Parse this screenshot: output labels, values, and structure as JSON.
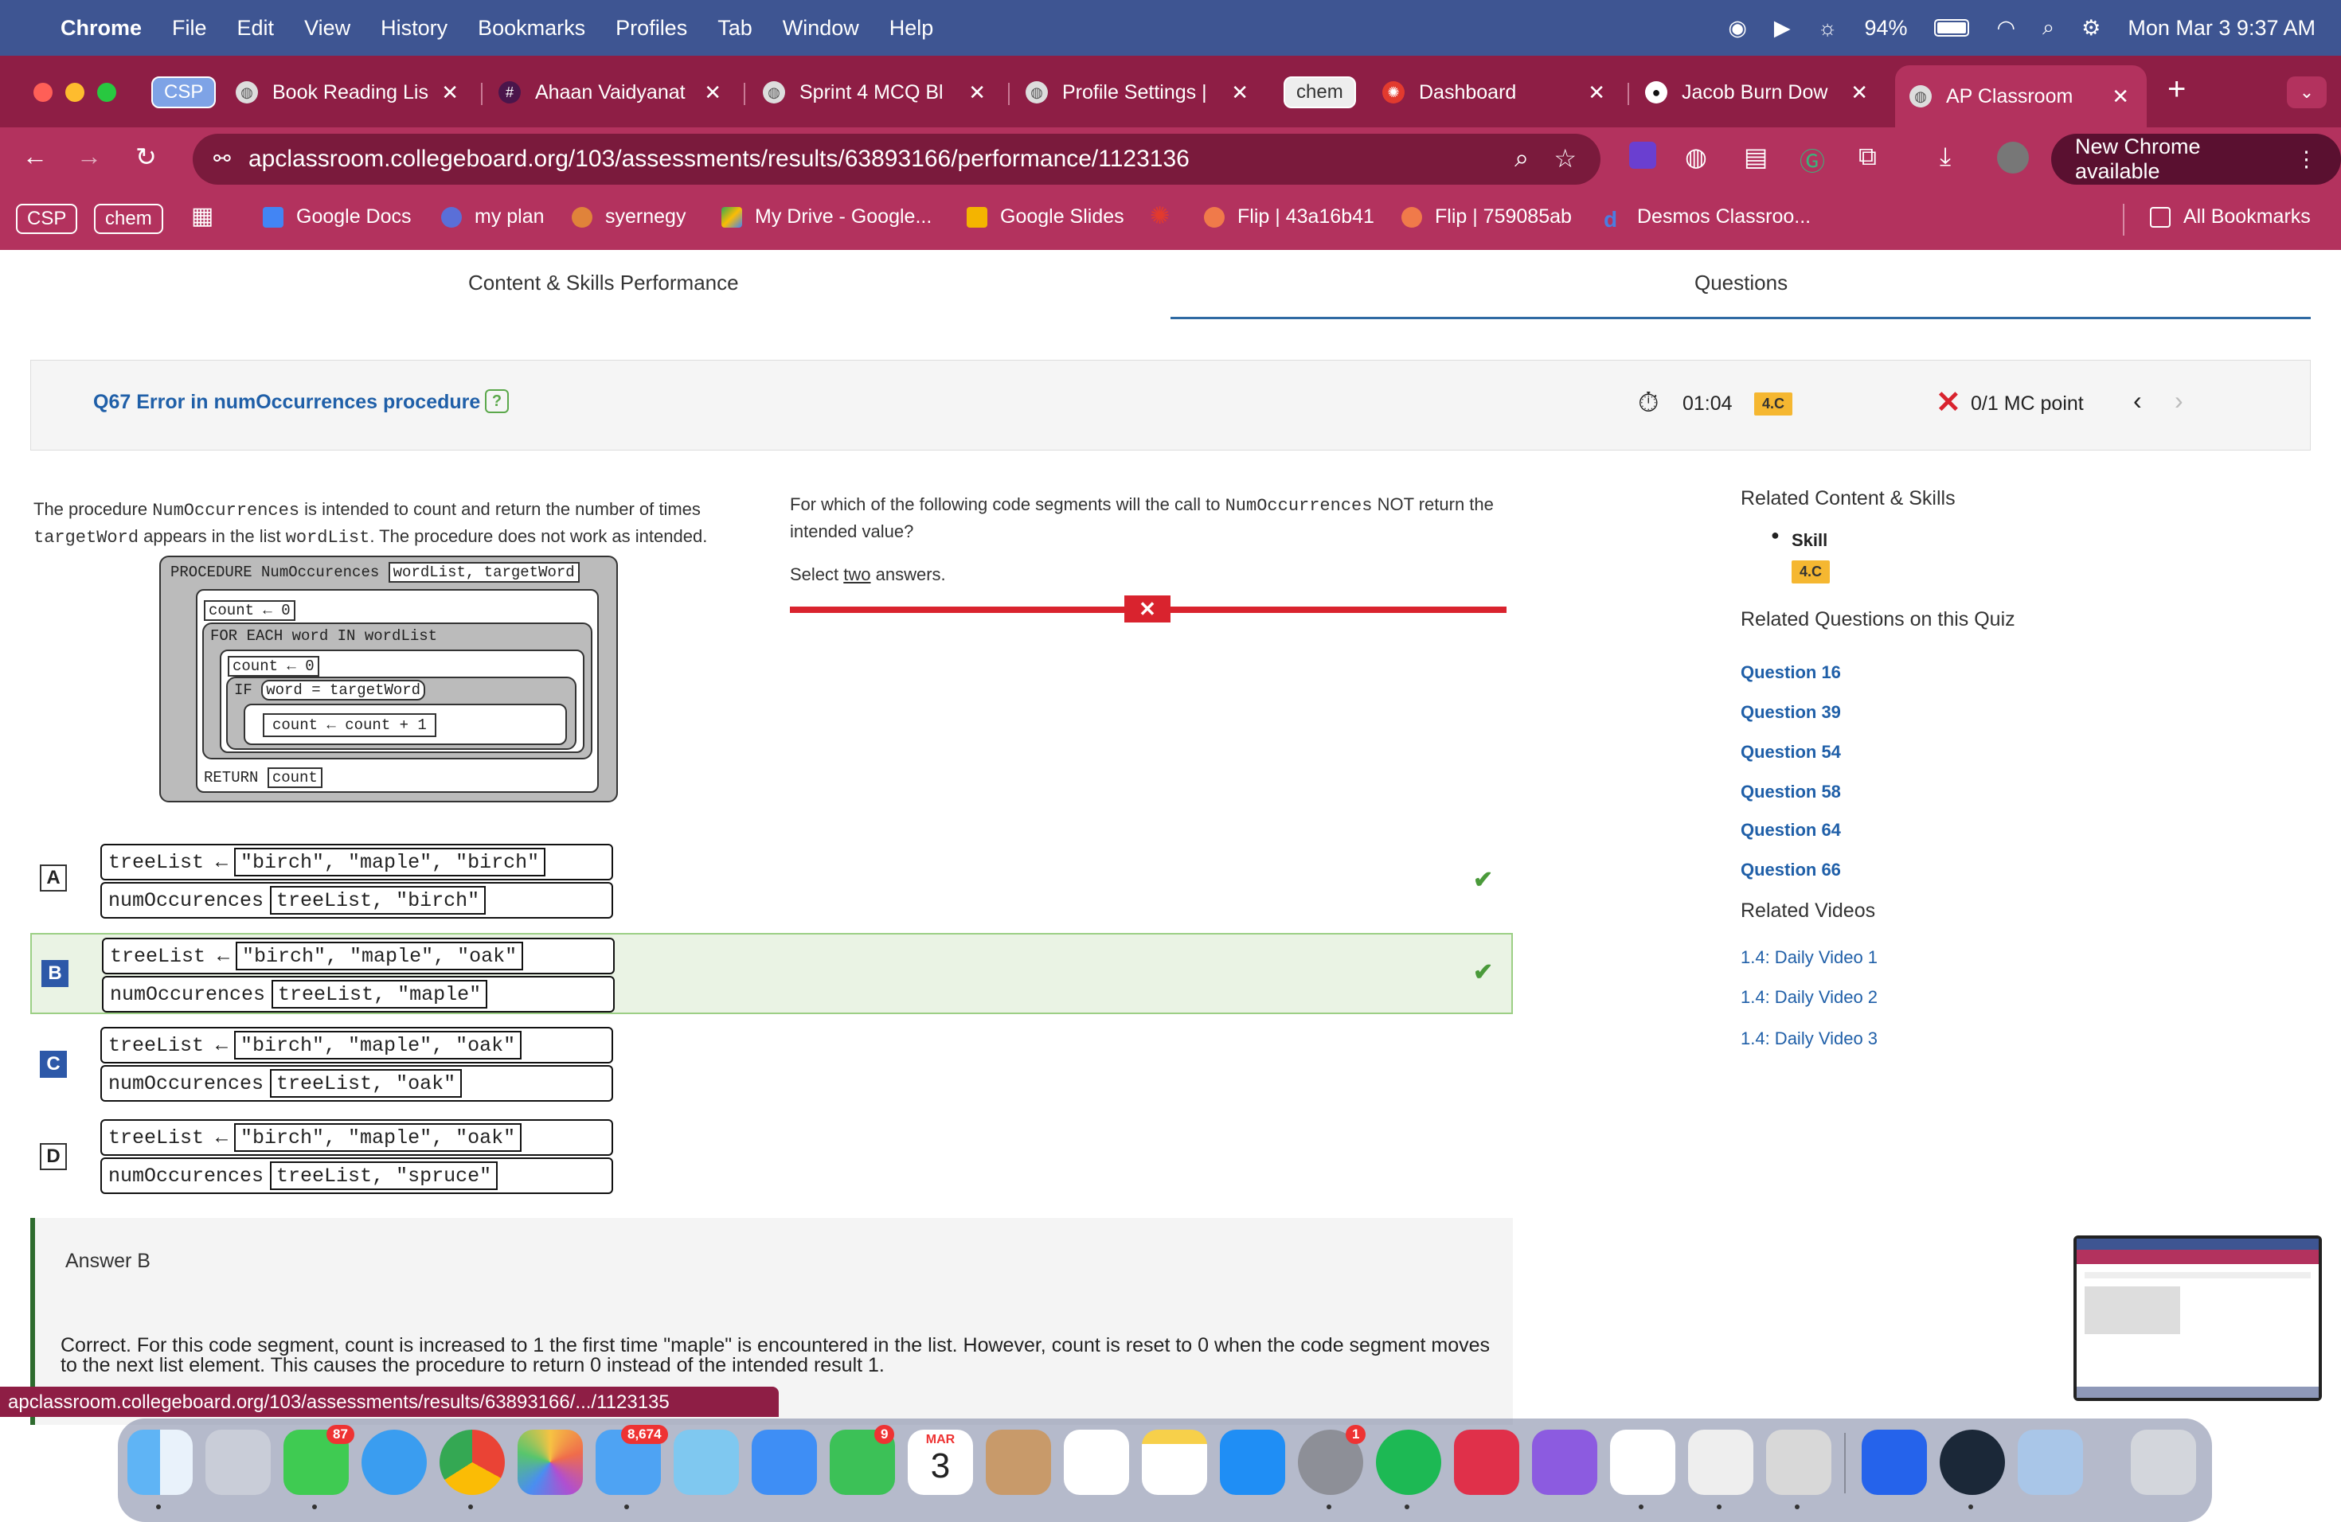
{
  "menubar": {
    "items": [
      "Chrome",
      "File",
      "Edit",
      "View",
      "History",
      "Bookmarks",
      "Profiles",
      "Tab",
      "Window",
      "Help"
    ],
    "battery": "94%",
    "datetime": "Mon Mar 3  9:37 AM"
  },
  "tabs": [
    {
      "group": "CSP"
    },
    {
      "label": "Book Reading Lis"
    },
    {
      "label": "Ahaan Vaidyanat"
    },
    {
      "label": "Sprint 4 MCQ Bl"
    },
    {
      "label": "Profile Settings |"
    },
    {
      "group": "chem"
    },
    {
      "label": "Dashboard"
    },
    {
      "label": "Jacob Burn Dow"
    },
    {
      "label": "AP Classroom",
      "active": true
    }
  ],
  "address": {
    "url": "apclassroom.collegeboard.org/103/assessments/results/63893166/performance/1123136"
  },
  "new_chrome": "New Chrome available",
  "bookmarks": {
    "groups": [
      "CSP",
      "chem"
    ],
    "items": [
      "Google Docs",
      "my plan",
      "syernegy",
      "My Drive - Google...",
      "Google Slides",
      "Flip | 43a16b41",
      "Flip | 759085ab",
      "Desmos Classroo..."
    ],
    "all": "All Bookmarks"
  },
  "page_tabs": {
    "left": "Content & Skills Performance",
    "right": "Questions"
  },
  "question": {
    "title": "Q67 Error in numOccurrences procedure",
    "help": "?",
    "time": "01:04",
    "skill_badge": "4.C",
    "score": "0/1 MC point"
  },
  "stem": {
    "p1a": "The procedure ",
    "p1code1": "NumOccurrences",
    "p1b": " is intended to count and return the number of times ",
    "p1code2": "targetWord",
    "p1c": " appears in the list ",
    "p1code3": "wordList",
    "p1d": ". The procedure does not work as intended."
  },
  "procedure": {
    "header": "PROCEDURE NumOccurences",
    "params": "wordList, targetWord",
    "count_init": "count ← 0",
    "loop": "FOR EACH word IN wordList",
    "count_reset": "count ← 0",
    "if": "IF",
    "cond": "word = targetWord",
    "inc": "count ← count + 1",
    "ret": "RETURN",
    "ret_val": "count"
  },
  "prompt": {
    "a": "For which of the following code segments will the call to ",
    "code": "NumOccurrences",
    "b": " NOT return the intended value?",
    "select_pre": "Select ",
    "select_two": "two",
    "select_post": " answers."
  },
  "answers": [
    {
      "letter": "A",
      "list": "\"birch\", \"maple\", \"birch\"",
      "call": "treeList, \"birch\""
    },
    {
      "letter": "B",
      "list": "\"birch\", \"maple\", \"oak\"",
      "call": "treeList, \"maple\""
    },
    {
      "letter": "C",
      "list": "\"birch\", \"maple\", \"oak\"",
      "call": "treeList, \"oak\""
    },
    {
      "letter": "D",
      "list": "\"birch\", \"maple\", \"oak\"",
      "call": "treeList, \"spruce\""
    }
  ],
  "code_labels": {
    "assign": "treeList ←",
    "call": "numOccurences"
  },
  "sidebar": {
    "related_title": "Related Content & Skills",
    "skill_label": "Skill",
    "skill_badge": "4.C",
    "rq_title": "Related Questions on this Quiz",
    "questions": [
      "Question 16",
      "Question 39",
      "Question 54",
      "Question 58",
      "Question 64",
      "Question 66"
    ],
    "rv_title": "Related Videos",
    "videos": [
      "1.4: Daily Video 1",
      "1.4: Daily Video 2",
      "1.4: Daily Video 3"
    ]
  },
  "explanation": {
    "title": "Answer B",
    "text": "Correct. For this code segment,  count  is increased to  1  the first time  \"maple\"  is encountered in the list. However,  count  is reset to  0  when the code segment moves to the next list element. This causes the procedure to return  0  instead of the intended result  1."
  },
  "status_url": "apclassroom.collegeboard.org/103/assessments/results/63893166/.../1123135",
  "dock": {
    "badges": {
      "messages": "87",
      "mail": "8,674",
      "facetime": "9",
      "settings": "1"
    },
    "calendar_month": "MAR",
    "calendar_day": "3"
  },
  "colors": {
    "menubar": "#3e5592",
    "chrome_dark": "#8e1e45",
    "chrome": "#b3325e",
    "link": "#1f5fa8",
    "badge": "#f5b731",
    "wrong": "#d9232e",
    "correct": "#4a9a3a"
  }
}
